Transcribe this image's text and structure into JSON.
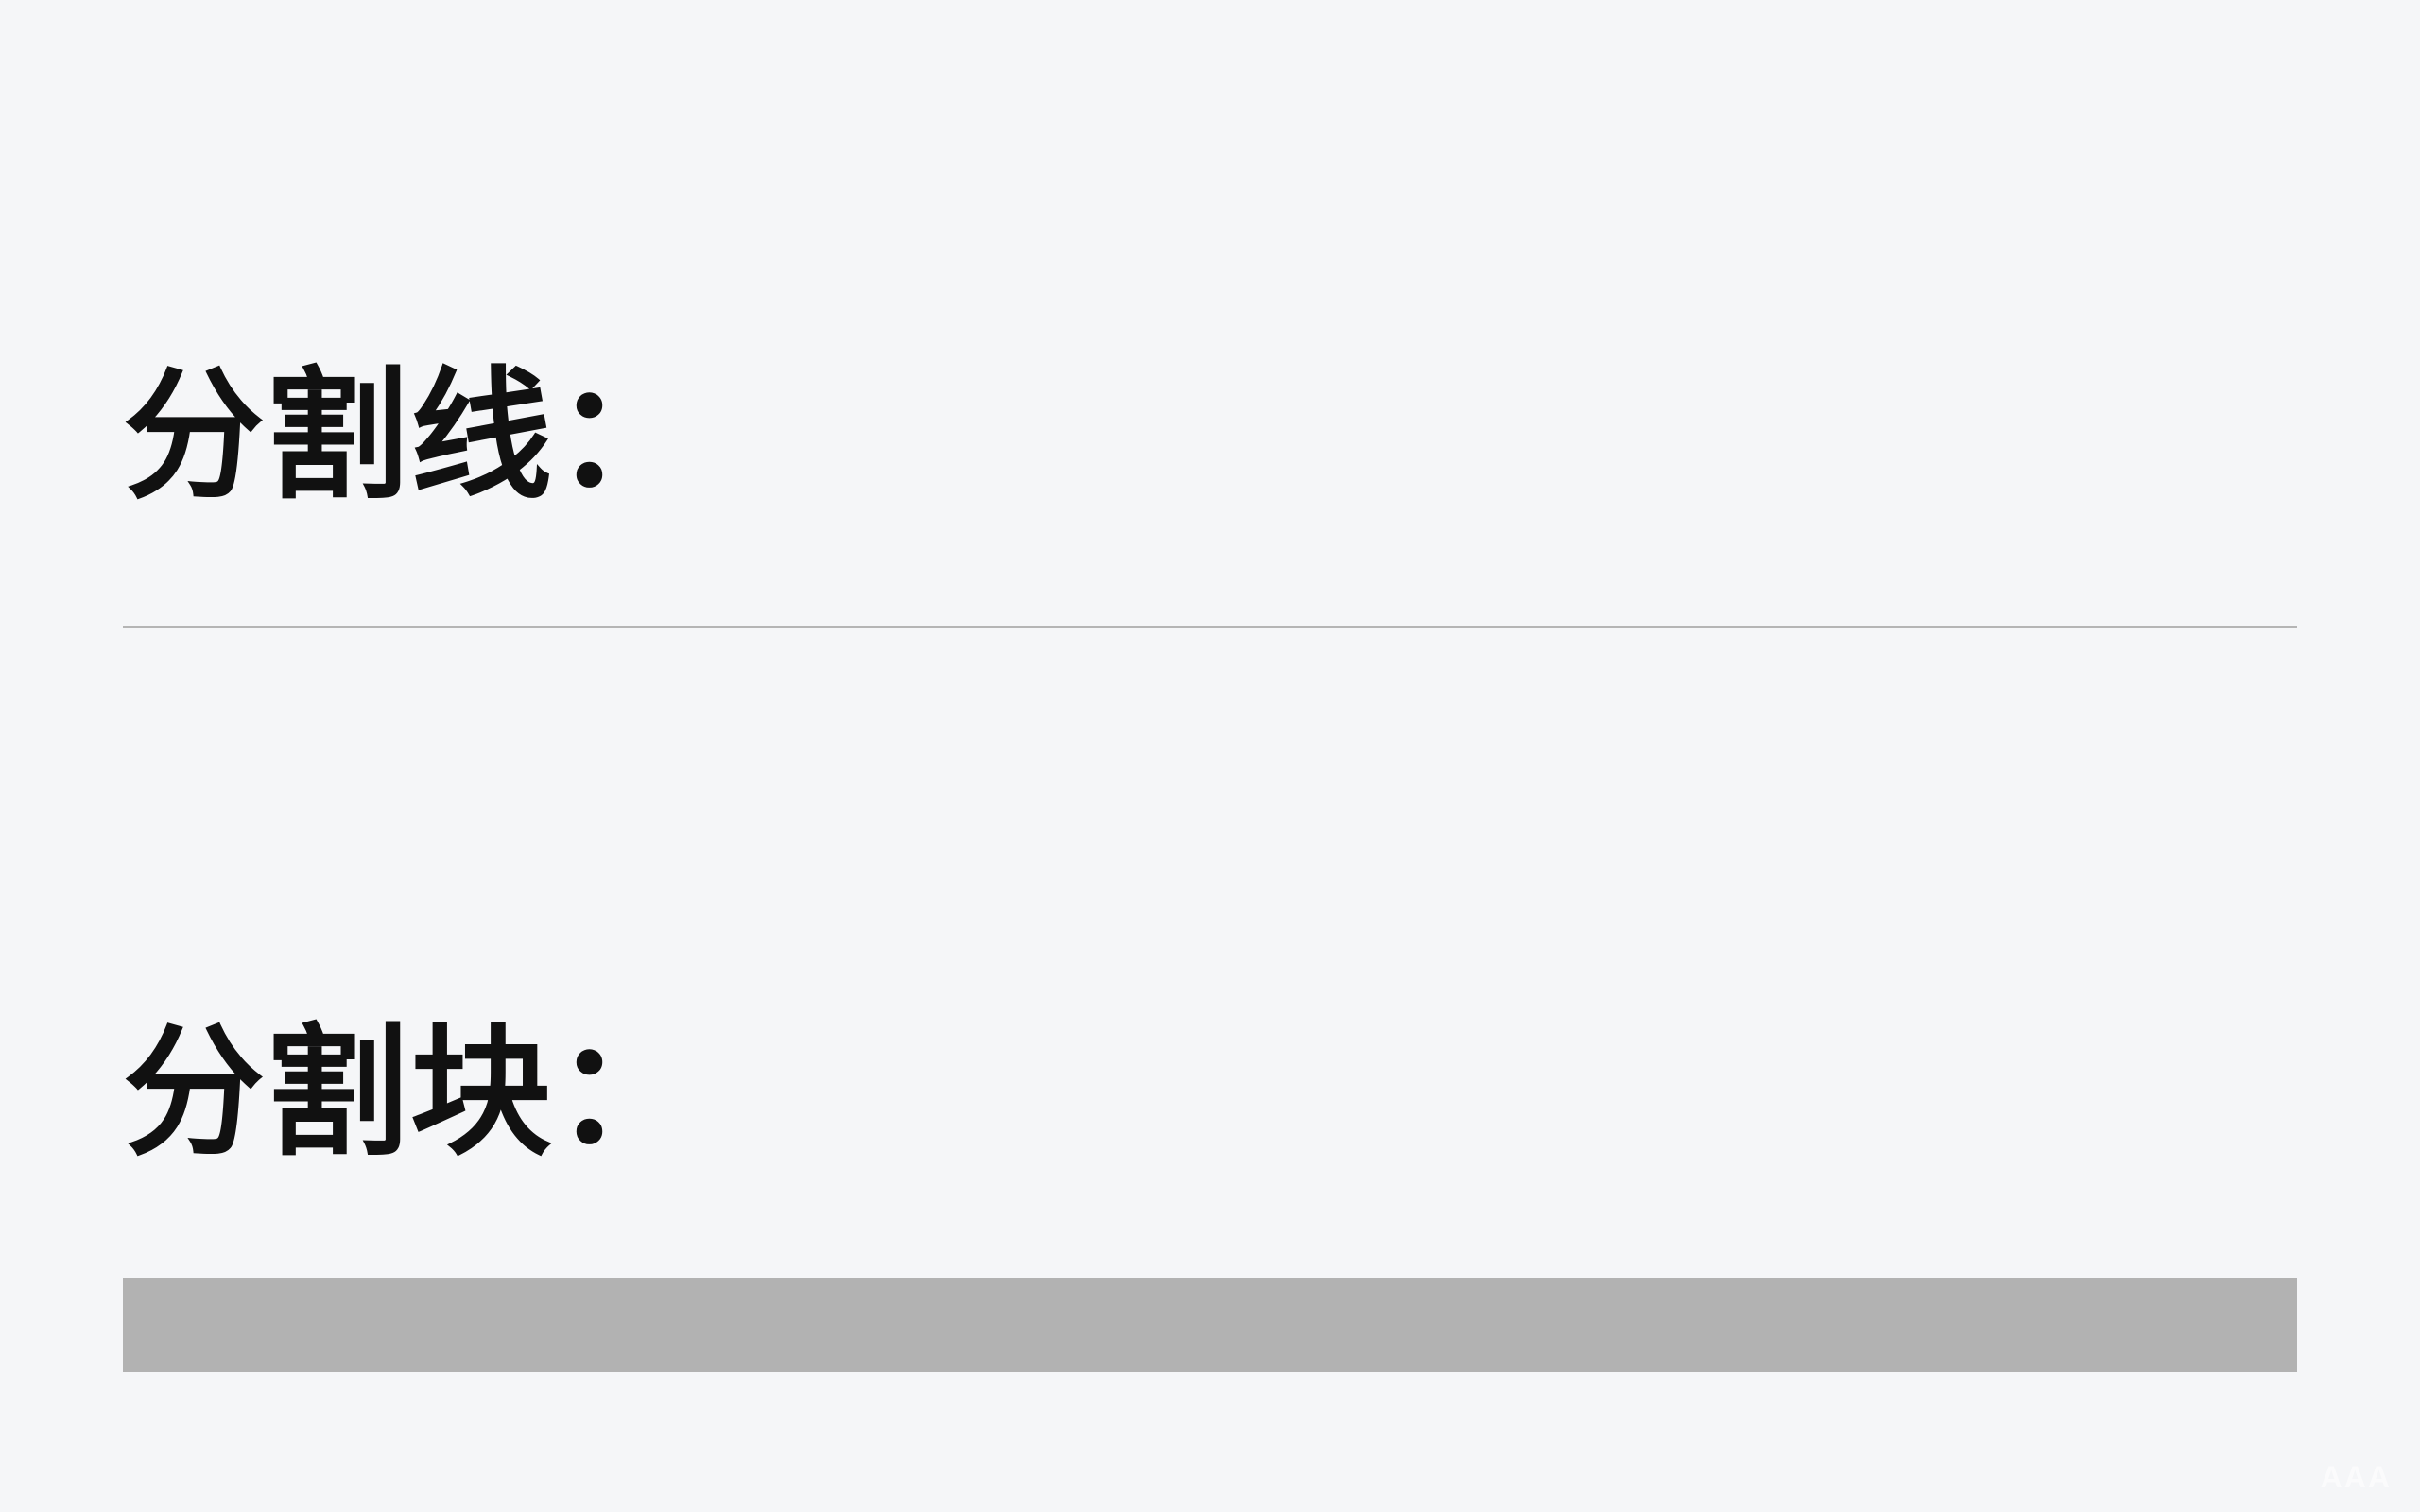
{
  "sections": {
    "divider_line": {
      "heading": "分割线："
    },
    "divider_block": {
      "heading": "分割块："
    }
  },
  "watermark": "AAA",
  "colors": {
    "background": "#f5f6f8",
    "text": "#111111",
    "divider_line": "#b5b5b5",
    "divider_block": "#b2b2b2"
  }
}
